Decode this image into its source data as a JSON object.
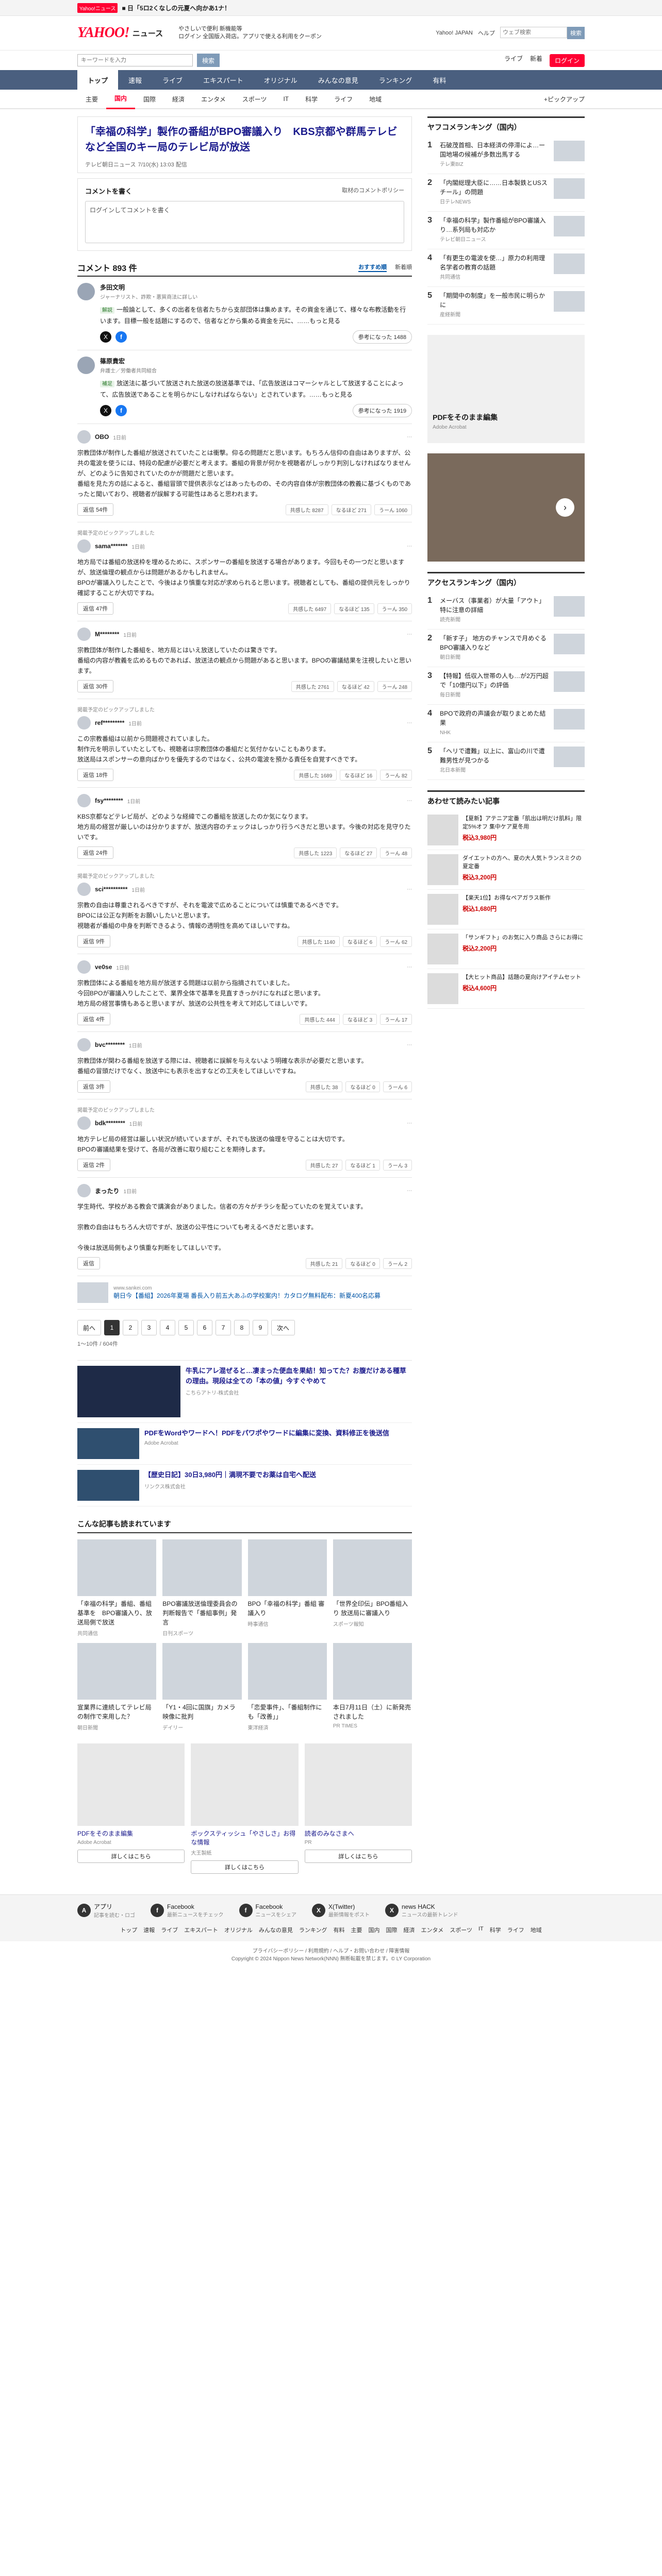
{
  "topstrip": {
    "badge": "Yahoo!ニュース",
    "text": "■ 日「5ロ2くなしの元夏へ向かあ1ナ！"
  },
  "header": {
    "logo": "YAHOO!",
    "logo_sub": "ニュース",
    "promo_line1": "やさしいで便利 新機能等",
    "promo_line2": "ログイン 全国版入荷店。アプリで使える利用をクーポン",
    "links": [
      "Yahoo! JAPAN",
      "ヘルプ"
    ],
    "search_placeholder": "ウェブ検索",
    "search_btn": "検索"
  },
  "searchbar": {
    "placeholder": "キーワードを入力",
    "btn": "検索",
    "links": [
      "ライブ",
      "新着"
    ],
    "login": "ログイン"
  },
  "gnav": [
    "トップ",
    "速報",
    "ライブ",
    "エキスパート",
    "オリジナル",
    "みんなの意見",
    "ランキング",
    "有料"
  ],
  "subnav": [
    "主要",
    "国内",
    "国際",
    "経済",
    "エンタメ",
    "スポーツ",
    "IT",
    "科学",
    "ライフ",
    "地域"
  ],
  "subnav_pickup": "+ピックアップ",
  "article": {
    "title": "「幸福の科学」製作の番組がBPO審議入り　KBS京都や群馬テレビなど全国のキー局のテレビ局が放送",
    "source": "テレビ朝日ニュース",
    "time": "7/10(水) 13:03 配信"
  },
  "comment_box": {
    "title": "コメントを書く",
    "policy": "取材のコメントポリシー",
    "placeholder": "ログインしてコメントを書く"
  },
  "comments_header": {
    "count": "コメント 893 件",
    "sort": [
      "おすすめ順",
      "新着順"
    ]
  },
  "experts": [
    {
      "name": "多田文明",
      "title": "ジャーナリスト、詐欺・悪質商法に詳しい",
      "tag": "解説",
      "text": "一般論として、多くの出者を信者たちから支部団体は集めます。その資金を通じて、様々な布教活動を行います。目標一般を話題にするので、信者などから集める資金を元に、……もっと見る",
      "helpful": "参考になった 1488"
    },
    {
      "name": "篠原貴宏",
      "title": "弁護士／労働者共同組合",
      "tag": "補足",
      "text": "放送法に基づいて放送された放送の放送基準では、「広告放送はコマーシャルとして放送することによって、広告放送であることを明らかにしなければならない」とされています。……もっと見る",
      "helpful": "参考になった 1919"
    }
  ],
  "comments": [
    {
      "sponsored": "",
      "user": "OBO",
      "time": "1日前",
      "text": "宗教団体が制作した番組が放送されていたことは衝撃。仰るの問題だと思います。もちろん信仰の自由はありますが、公共の電波を使うには、特段の配慮が必要だと考えます。番組の背景が何かを視聴者がしっかり判別しなければなりませんが、どのように告知されていたのかが問題だと思います。\n番組を見た方の話によると、番組冒頭で提供表示などはあったものの、その内容自体が宗教団体の教義に基づくものであったと聞いており、視聴者が誤解する可能性はあると思われます。",
      "reply": "返信 54件",
      "react": [
        "共感した 8287",
        "なるほど 271",
        "うーん 1060"
      ]
    },
    {
      "sponsored": "掲載予定のピックアップしました",
      "user": "sama*******",
      "time": "1日前",
      "text": "地方局では番組の放送枠を埋めるために、スポンサーの番組を放送する場合があります。今回もその一つだと思いますが、放送倫理の観点からは問題があるかもしれません。\nBPOが審議入りしたことで、今後はより慎重な対応が求められると思います。視聴者としても、番組の提供元をしっかり確認することが大切ですね。",
      "reply": "返信 47件",
      "react": [
        "共感した 6497",
        "なるほど 135",
        "うーん 350"
      ]
    },
    {
      "sponsored": "",
      "user": "M********",
      "time": "1日前",
      "text": "宗教団体が制作した番組を、地方局とはいえ放送していたのは驚きです。\n番組の内容が教義を広めるものであれば、放送法の観点から問題があると思います。BPOの審議結果を注視したいと思います。",
      "reply": "返信 30件",
      "react": [
        "共感した 2761",
        "なるほど 42",
        "うーん 248"
      ]
    },
    {
      "sponsored": "掲載予定のピックアップしました",
      "user": "ref*********",
      "time": "1日前",
      "text": "この宗教番組は以前から問題視されていました。\n制作元を明示していたとしても、視聴者は宗教団体の番組だと気付かないこともあります。\n放送局はスポンサーの意向ばかりを優先するのではなく、公共の電波を預かる責任を自覚すべきです。",
      "reply": "返信 18件",
      "react": [
        "共感した 1689",
        "なるほど 16",
        "うーん 82"
      ]
    },
    {
      "sponsored": "",
      "user": "fsy********",
      "time": "1日前",
      "text": "KBS京都などテレビ局が、どのような経緯でこの番組を放送したのか気になります。\n地方局の経営が厳しいのは分かりますが、放送内容のチェックはしっかり行うべきだと思います。今後の対応を見守りたいです。",
      "reply": "返信 24件",
      "react": [
        "共感した 1223",
        "なるほど 27",
        "うーん 48"
      ]
    },
    {
      "sponsored": "掲載予定のピックアップしました",
      "user": "sci**********",
      "time": "1日前",
      "text": "宗教の自由は尊重されるべきですが、それを電波で広めることについては慎重であるべきです。\nBPOには公正な判断をお願いしたいと思います。\n視聴者が番組の中身を判断できるよう、情報の透明性を高めてほしいですね。",
      "reply": "返信 9件",
      "react": [
        "共感した 1140",
        "なるほど 6",
        "うーん 62"
      ]
    },
    {
      "sponsored": "",
      "user": "ve0se",
      "time": "1日前",
      "text": "宗教団体による番組を地方局が放送する問題は以前から指摘されていました。\n今回BPOが審議入りしたことで、業界全体で基準を見直すきっかけになればと思います。\n地方局の経営事情もあると思いますが、放送の公共性を考えて対応してほしいです。",
      "reply": "返信 4件",
      "react": [
        "共感した 444",
        "なるほど 3",
        "うーん 17"
      ]
    },
    {
      "sponsored": "",
      "user": "bvc********",
      "time": "1日前",
      "text": "宗教団体が関わる番組を放送する際には、視聴者に誤解を与えないよう明確な表示が必要だと思います。\n番組の冒頭だけでなく、放送中にも表示を出すなどの工夫をしてほしいですね。",
      "reply": "返信 3件",
      "react": [
        "共感した 38",
        "なるほど 0",
        "うーん 6"
      ]
    },
    {
      "sponsored": "掲載予定のピックアップしました",
      "user": "bdk********",
      "time": "1日前",
      "text": "地方テレビ局の経営は厳しい状況が続いていますが、それでも放送の倫理を守ることは大切です。\nBPOの審議結果を受けて、各局が改善に取り組むことを期待します。",
      "reply": "返信 2件",
      "react": [
        "共感した 27",
        "なるほど 1",
        "うーん 3"
      ]
    },
    {
      "sponsored": "",
      "user": "まったり",
      "time": "1日前",
      "text": "学生時代、学校がある教会で講演会がありました。信者の方々がチラシを配っていたのを覚えています。\n\n宗教の自由はもちろん大切ですが、放送の公平性についても考えるべきだと思います。\n\n今後は放送局側もより慎重な判断をしてほしいです。",
      "reply": "返信",
      "react": [
        "共感した 21",
        "なるほど 0",
        "うーん 2"
      ]
    }
  ],
  "related": {
    "source": "www.sankei.com",
    "text": "朝日今【番組】2026年夏場 番長入り前五大あふの学校案内！カタログ無料配布：新夏400名応募"
  },
  "pager": {
    "prev": "前へ",
    "pages": [
      "1",
      "2",
      "3",
      "4",
      "5",
      "6",
      "7",
      "8",
      "9"
    ],
    "next": "次へ",
    "info": "1〜10件 / 604件"
  },
  "ads": [
    {
      "title": "牛乳にアレ混ぜると…凄まった便血を果結！知ってた？お腹だけある種草の理由。現段は全ての「本の値」今すぐやめて",
      "src": "こちらアトリ-株式会社"
    },
    {
      "title": "PDFをWordやワードへ！PDFをパワポやワードに編集に変換、資料修正を後送信",
      "src": "Adobe Acrobat"
    },
    {
      "title": "【歴史日記】30日3,980円｜満現不要でお薬は自宅へ配送",
      "src": "リンクス株式会社"
    }
  ],
  "popular_title": "こんな記事も読まれています",
  "popular": [
    {
      "text": "「幸福の科学」番組、番組基準を　BPO審議入り、放送局側で放送",
      "src": "共同通信"
    },
    {
      "text": "BPO審議放送倫理委員会の判断報告で「番組事例」発言",
      "src": "日刊スポーツ"
    },
    {
      "text": "BPO「幸福の科学」番組 審議入り",
      "src": "時事通信"
    },
    {
      "text": "「世界全印伝」BPO番組入り 放送局に審議入り",
      "src": "スポーツ報知"
    },
    {
      "text": "宣業界に連続してテレビ局の制作で来用した？",
      "src": "朝日新聞"
    },
    {
      "text": "「Y1・4回に国旗」カメラ映像に批判",
      "src": "デイリー"
    },
    {
      "text": "「恋愛事件」、「番組制作にも「改善」」",
      "src": "東洋経済"
    },
    {
      "text": "本日7月11日（土）に新発売されました",
      "src": "PR TIMES"
    }
  ],
  "bottom_ads": [
    {
      "text": "PDFをそのまま編集",
      "btn": "詳しくはこちら",
      "src": "Adobe Acrobat"
    },
    {
      "text": "ボックスティッシュ「やさしさ」お得な情報",
      "btn": "詳しくはこちら",
      "src": "大王製紙"
    },
    {
      "text": "読者のみなさまへ",
      "btn": "詳しくはこちら",
      "src": "PR"
    }
  ],
  "side": {
    "access_title": "ヤフコメランキング（国内）",
    "access_items": [
      {
        "text": "石破茂首相、日本経済の停滞によ…ー国地場の候補が多数出馬する",
        "src": "テレ東BIZ"
      },
      {
        "text": "「内閣総理大臣に……日本製鉄とUSスチール」の問題",
        "src": "日テレNEWS"
      },
      {
        "text": "「幸福の科学」製作番組がBPO審議入り…系列局も対応か",
        "src": "テレビ朝日ニュース"
      },
      {
        "text": "「有更生の電波を使…」原力の利用理 名学者の教育の話題",
        "src": "共同通信"
      },
      {
        "text": "「期間中の制度」を一般市民に明らかに",
        "src": "産経新聞"
      }
    ],
    "pdf_ad": "PDFをそのまま編集",
    "pdf_ad_src": "Adobe Acrobat",
    "access2_title": "アクセスランキング（国内）",
    "access2_items": [
      {
        "text": "メーバス（事業者）が大量「アウト」特に注意の詳細",
        "src": "読売新聞"
      },
      {
        "text": "「新す子」 地方のチャンスで月めぐるBPO審議入りなど",
        "src": "朝日新聞"
      },
      {
        "text": "【特報】低収入世帯の人も…が2万円超で「10億円以下」の評価",
        "src": "毎日新聞"
      },
      {
        "text": "BPOで政府の声議会が取りまとめた結果",
        "src": "NHK"
      },
      {
        "text": "「ヘリで遭難」以上に、富山の川で遭難男性が見つかる",
        "src": "北日本新聞"
      }
    ],
    "shop_title": "あわせて読みたい記事",
    "shop_items": [
      {
        "text": "【夏新】アテニア定番「肌出は明だけ肌料」限定5%オフ 集中ケア夏冬用",
        "price": "税込3,980円"
      },
      {
        "text": "ダイエットの方へ、夏の大人気トランスミクの夏定番",
        "price": "税込3,200円"
      },
      {
        "text": "【楽天1位】お得なペアガラス新作",
        "price": "税込1,680円"
      },
      {
        "text": "「サンギフト」のお気に入り商品 さらにお得に",
        "price": "税込2,200円"
      },
      {
        "text": "【大ヒット商品】話題の夏向けアイテムセット",
        "price": "税込4,600円"
      }
    ]
  },
  "footer": {
    "sns": [
      {
        "icon": "A",
        "name": "アプリ",
        "desc": "記事を読む・ロゴ"
      },
      {
        "icon": "f",
        "name": "Facebook",
        "desc": "最新ニュースをチェック"
      },
      {
        "icon": "f",
        "name": "Facebook",
        "desc": "ニュースをシェア"
      },
      {
        "icon": "X",
        "name": "X(Twitter)",
        "desc": "最新情報をポスト"
      },
      {
        "icon": "X",
        "name": "news HACK",
        "desc": "ニュースの最新トレンド"
      }
    ],
    "links": [
      "トップ",
      "速報",
      "ライブ",
      "エキスパート",
      "オリジナル",
      "みんなの意見",
      "ランキング",
      "有料",
      "主要",
      "国内",
      "国際",
      "経済",
      "エンタメ",
      "スポーツ",
      "IT",
      "科学",
      "ライフ",
      "地域"
    ],
    "legal": "プライバシーポリシー / 利用規約 / ヘルプ・お問い合わせ / 障害情報",
    "copyright": "Copyright © 2024 Nippon News Network(NNN) 無断転載を禁じます。© LY Corporation"
  }
}
